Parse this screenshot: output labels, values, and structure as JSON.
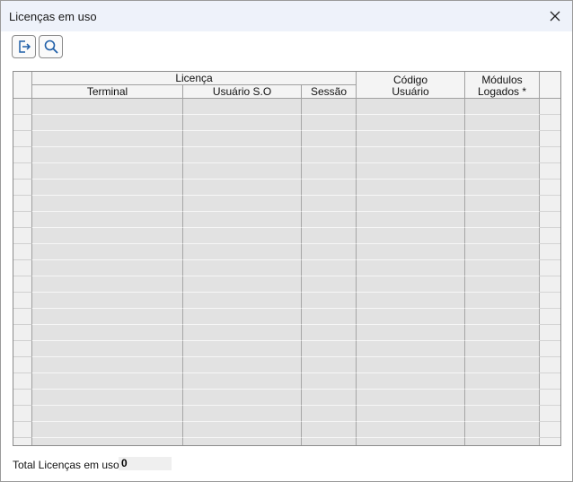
{
  "window": {
    "title": "Licenças em uso",
    "close_icon": "close-icon"
  },
  "toolbar": {
    "exit_icon": "exit-icon",
    "search_icon": "search-icon"
  },
  "grid": {
    "group_header": "Licença",
    "columns": {
      "terminal": "Terminal",
      "usuario_so": "Usuário S.O",
      "sessao": "Sessão",
      "codigo_usuario_line1": "Código",
      "codigo_usuario_line2": "Usuário",
      "modulos_line1": "Módulos",
      "modulos_line2": "Logados *"
    },
    "rows": [
      {},
      {},
      {},
      {},
      {},
      {},
      {},
      {},
      {},
      {},
      {},
      {},
      {},
      {},
      {},
      {},
      {},
      {},
      {},
      {},
      {},
      {},
      {}
    ]
  },
  "footer": {
    "total_label": "Total Licenças em uso:",
    "total_value": "0"
  }
}
